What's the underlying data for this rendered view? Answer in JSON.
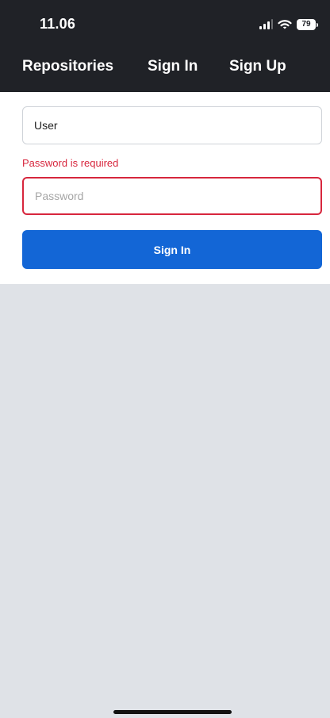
{
  "status_bar": {
    "time": "11.06",
    "battery_level": "79",
    "signal_icon": "signal-strength-icon",
    "wifi_icon": "wifi-icon",
    "battery_icon": "battery-icon"
  },
  "nav": {
    "repositories_label": "Repositories",
    "sign_in_label": "Sign In",
    "sign_up_label": "Sign Up"
  },
  "form": {
    "user_value": "User",
    "password_error": "Password is required",
    "password_value": "",
    "password_placeholder": "Password",
    "sign_in_button_label": "Sign In"
  },
  "colors": {
    "header_background": "#202227",
    "error": "#d7263d",
    "primary_button": "#1366d6",
    "page_background": "#dfe2e7"
  }
}
